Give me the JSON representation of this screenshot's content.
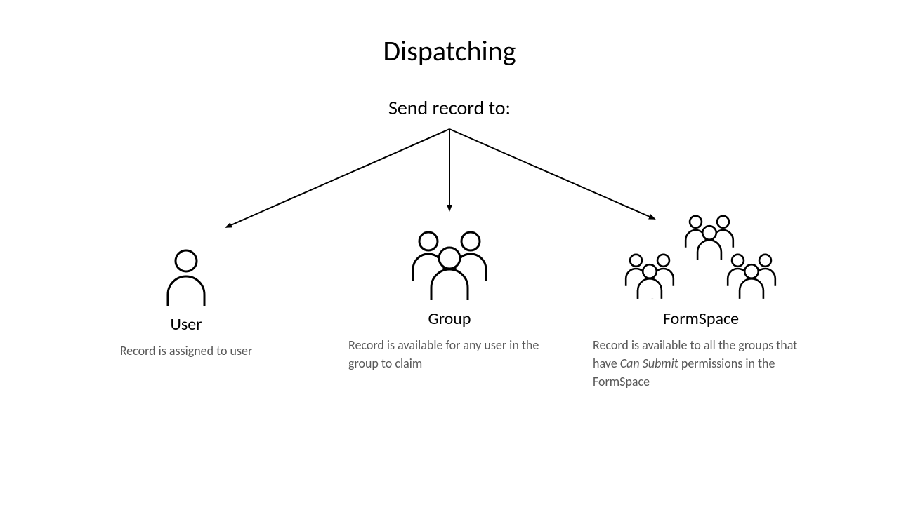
{
  "title": "Dispatching",
  "subtitle": "Send record to:",
  "branches": {
    "user": {
      "label": "User",
      "desc": "Record is assigned to user"
    },
    "group": {
      "label": "Group",
      "desc": "Record is available for any user in the group to claim"
    },
    "formspace": {
      "label": "FormSpace",
      "desc_pre": "Record is available to all the groups that have ",
      "desc_em": "Can Submit",
      "desc_post": " permissions in the FormSpace"
    }
  }
}
